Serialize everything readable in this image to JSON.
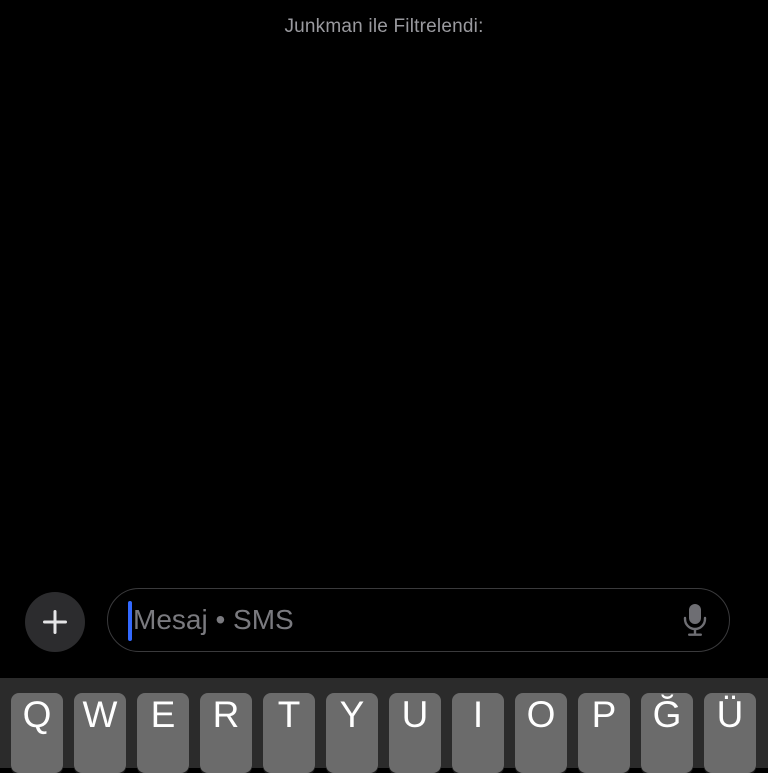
{
  "header": {
    "filter_text": "Junkman ile Filtrelendi:"
  },
  "compose": {
    "plus_icon": "plus-icon",
    "placeholder": "Mesaj • SMS",
    "mic_icon": "microphone-icon",
    "caret_color": "#3369ff"
  },
  "keyboard": {
    "row1": [
      "Q",
      "W",
      "E",
      "R",
      "T",
      "Y",
      "U",
      "I",
      "O",
      "P",
      "Ğ",
      "Ü"
    ]
  }
}
